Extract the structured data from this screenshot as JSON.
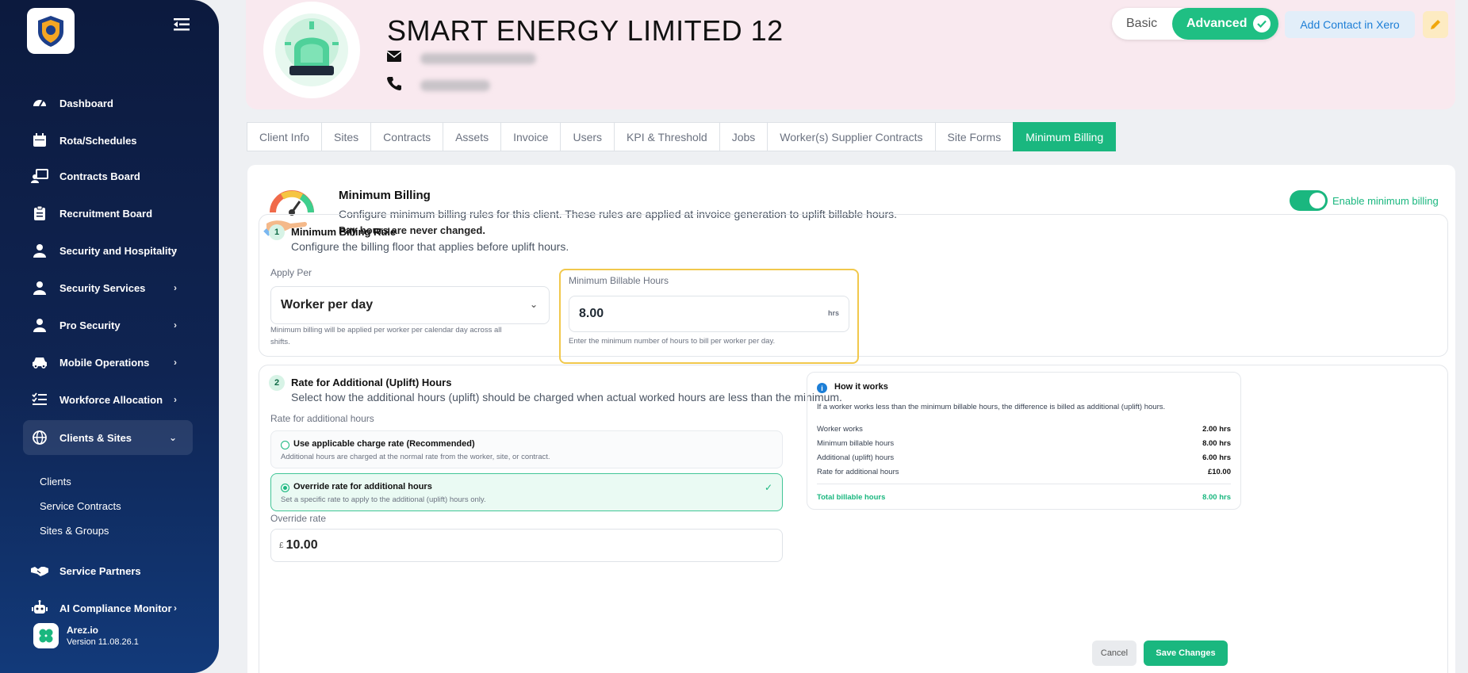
{
  "sidebar": {
    "items": [
      {
        "label": "Dashboard",
        "icon": "dashboard-icon",
        "chevron": ""
      },
      {
        "label": "Rota/Schedules",
        "icon": "calendar-icon",
        "chevron": ""
      },
      {
        "label": "Contracts Board",
        "icon": "contracts-icon",
        "chevron": ""
      },
      {
        "label": "Recruitment Board",
        "icon": "clipboard-icon",
        "chevron": ""
      },
      {
        "label": "Security and Hospitality",
        "icon": "user-icon",
        "chevron": "›"
      },
      {
        "label": "Security Services",
        "icon": "user-icon",
        "chevron": "›"
      },
      {
        "label": "Pro Security",
        "icon": "user-icon",
        "chevron": "›"
      },
      {
        "label": "Mobile Operations",
        "icon": "car-icon",
        "chevron": "›"
      },
      {
        "label": "Workforce Allocation",
        "icon": "list-icon",
        "chevron": "›"
      },
      {
        "label": "Clients & Sites",
        "icon": "globe-icon",
        "chevron": "⌄"
      },
      {
        "label": "Service Partners",
        "icon": "handshake-icon",
        "chevron": ""
      },
      {
        "label": "AI Compliance Monitor",
        "icon": "robot-icon",
        "chevron": "›"
      }
    ],
    "subitems": [
      "Clients",
      "Service Contracts",
      "Sites & Groups"
    ],
    "brand_name": "Arez.io",
    "version": "Version 11.08.26.1"
  },
  "header": {
    "company": "SMART ENERGY LIMITED 12",
    "mode_basic": "Basic",
    "mode_advanced": "Advanced",
    "xero_button": "Add Contact in Xero"
  },
  "tabs": [
    "Client Info",
    "Sites",
    "Contracts",
    "Assets",
    "Invoice",
    "Users",
    "KPI & Threshold",
    "Jobs",
    "Worker(s) Supplier Contracts",
    "Site Forms",
    "Minimum Billing"
  ],
  "active_tab": "Minimum Billing",
  "billing": {
    "title": "Minimum Billing",
    "desc": "Configure minimum billing rules for this client. These rules are applied at invoice generation to uplift billable hours.",
    "desc2": "Pay hours are never changed.",
    "enable_label": "Enable minimum billing",
    "enabled": true
  },
  "rule": {
    "num": "1",
    "title": "Minimum Billing Rule",
    "subtitle": "Configure the billing floor that applies before uplift hours.",
    "apply_label": "Apply Per",
    "apply_value": "Worker per day",
    "apply_help": "Minimum billing will be applied per worker per calendar day across all shifts.",
    "hours_label": "Minimum Billable Hours",
    "hours_value": "8.00",
    "hours_unit": "hrs",
    "hours_help": "Enter the minimum number of hours to bill per worker per day."
  },
  "uplift": {
    "num": "2",
    "title": "Rate for Additional (Uplift) Hours",
    "subtitle": "Select how the additional hours (uplift) should be charged when actual worked hours are less than the minimum.",
    "rate_label": "Rate for additional hours",
    "opt1_title": "Use applicable charge rate (Recommended)",
    "opt1_desc": "Additional hours are charged at the normal rate from the worker, site, or contract.",
    "opt2_title": "Override rate for additional hours",
    "opt2_desc": "Set a specific rate to apply to the additional (uplift) hours only.",
    "override_label": "Override rate",
    "currency": "£",
    "override_value": "10.00"
  },
  "how": {
    "title": "How it works",
    "desc": "If a worker works less than the minimum billable hours, the difference is billed as additional (uplift) hours.",
    "rows": [
      {
        "label": "Worker works",
        "value": "2.00 hrs"
      },
      {
        "label": "Minimum billable hours",
        "value": "8.00 hrs"
      },
      {
        "label": "Additional (uplift) hours",
        "value": "6.00 hrs"
      },
      {
        "label": "Rate for additional hours",
        "value": "£10.00"
      }
    ],
    "total_label": "Total billable hours",
    "total_value": "8.00 hrs"
  },
  "actions": {
    "cancel": "Cancel",
    "save": "Save Changes"
  },
  "colors": {
    "accent": "#1ab77f",
    "sidebar": "#0c1a3e",
    "header_bg": "#f9e9ef",
    "xero": "#1c7ed6",
    "highlight": "#f1c84c"
  }
}
